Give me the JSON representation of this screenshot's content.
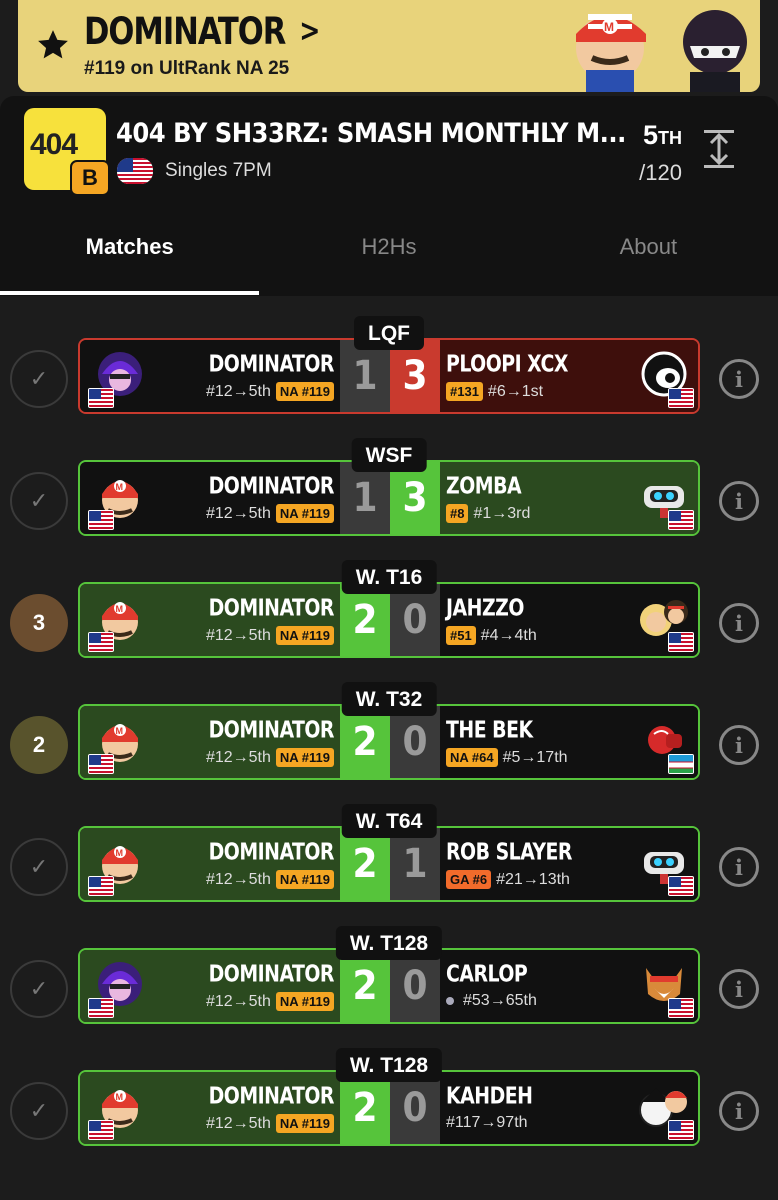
{
  "background_text": "",
  "banner": {
    "name": "DOMINATOR",
    "chevron": ">",
    "rank_text": "#119 on UltRank NA 25",
    "star_icon": "star-icon",
    "color": "#e8d37b"
  },
  "tournament": {
    "logo_text": "404",
    "logo_badge": "B",
    "title": "404 BY SH33RZ: SMASH MONTHLY M...",
    "event": "Singles 7PM",
    "placement": "5",
    "placement_suffix": "TH",
    "entrants": "/120"
  },
  "tabs": [
    {
      "label": "Matches",
      "active": true
    },
    {
      "label": "H2Hs",
      "active": false
    },
    {
      "label": "About",
      "active": false
    }
  ],
  "colors": {
    "win": "#56c43b",
    "loss": "#c93a2e",
    "tag": "#f5a623"
  },
  "matches": [
    {
      "round": "LQF",
      "result": "loss",
      "marker": {
        "type": "check",
        "text": "✓"
      },
      "p1": {
        "name": "DOMINATOR",
        "seed": "#12→5th",
        "tag": "NA #119",
        "char": "purple"
      },
      "p2": {
        "name": "PLOOPI XCX",
        "seed": "#6→1st",
        "tag": "#131",
        "char": "black",
        "flag": "us"
      },
      "score1": "1",
      "score2": "3"
    },
    {
      "round": "WSF",
      "result": "loss-green",
      "marker": {
        "type": "check",
        "text": "✓"
      },
      "p1": {
        "name": "DOMINATOR",
        "seed": "#12→5th",
        "tag": "NA #119",
        "char": "mario"
      },
      "p2": {
        "name": "ZOMBA",
        "seed": "#1→3rd",
        "tag": "#8",
        "char": "rob",
        "flag": "us"
      },
      "score1": "1",
      "score2": "3"
    },
    {
      "round": "W. T16",
      "result": "win",
      "marker": {
        "type": "bubble",
        "text": "3",
        "color": "#6b4d2f"
      },
      "p1": {
        "name": "DOMINATOR",
        "seed": "#12→5th",
        "tag": "NA #119",
        "char": "mario"
      },
      "p2": {
        "name": "JAHZZO",
        "seed": "#4→4th",
        "tag": "#51",
        "char": "ken",
        "flag": "us"
      },
      "score1": "2",
      "score2": "0"
    },
    {
      "round": "W. T32",
      "result": "win",
      "marker": {
        "type": "bubble",
        "text": "2",
        "color": "#58532c"
      },
      "p1": {
        "name": "DOMINATOR",
        "seed": "#12→5th",
        "tag": "NA #119",
        "char": "mario"
      },
      "p2": {
        "name": "THE BEK",
        "seed": "#5→17th",
        "tag": "NA #64",
        "char": "glove",
        "flag": "uz"
      },
      "score1": "2",
      "score2": "0"
    },
    {
      "round": "W. T64",
      "result": "win",
      "marker": {
        "type": "check",
        "text": "✓"
      },
      "p1": {
        "name": "DOMINATOR",
        "seed": "#12→5th",
        "tag": "NA #119",
        "char": "mario"
      },
      "p2": {
        "name": "ROB SLAYER",
        "seed": "#21→13th",
        "tag": "GA #6",
        "tag_style": "red",
        "char": "rob",
        "flag": "us"
      },
      "score1": "2",
      "score2": "1"
    },
    {
      "round": "W. T128",
      "result": "win",
      "marker": {
        "type": "check",
        "text": "✓"
      },
      "p1": {
        "name": "DOMINATOR",
        "seed": "#12→5th",
        "tag": "NA #119",
        "char": "purple"
      },
      "p2": {
        "name": "CARLOP",
        "seed": "#53→65th",
        "tag": "",
        "dot": true,
        "char": "fox",
        "flag": "us"
      },
      "score1": "2",
      "score2": "0"
    },
    {
      "round": "W. T128",
      "result": "win",
      "marker": {
        "type": "check",
        "text": "✓"
      },
      "p1": {
        "name": "DOMINATOR",
        "seed": "#12→5th",
        "tag": "NA #119",
        "char": "mario"
      },
      "p2": {
        "name": "KAHDEH",
        "seed": "#117→97th",
        "tag": "",
        "char": "kazuya",
        "flag": "us"
      },
      "score1": "2",
      "score2": "0"
    }
  ]
}
